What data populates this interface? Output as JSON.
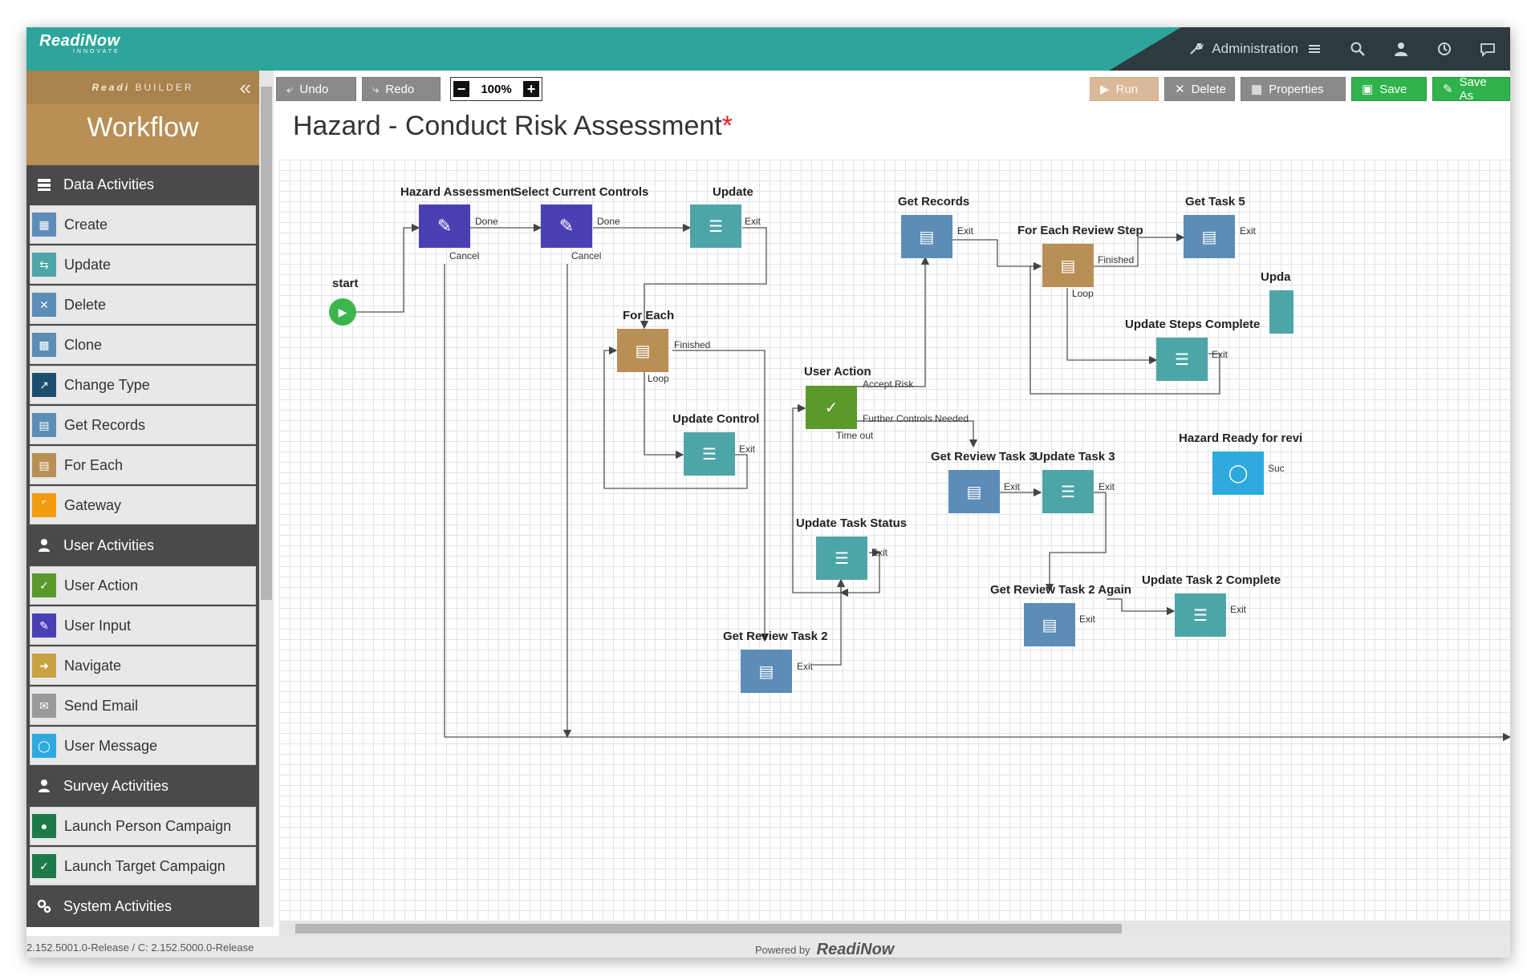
{
  "header": {
    "logo_main": "ReadiNow",
    "logo_sub": "INNOVATE",
    "admin_label": "Administration"
  },
  "sidebar": {
    "builder_small_a": "Readi",
    "builder_small_b": "BUILDER",
    "title": "Workflow",
    "categories": [
      {
        "label": "Data Activities"
      },
      {
        "label": "User Activities"
      },
      {
        "label": "Survey Activities"
      },
      {
        "label": "System Activities"
      }
    ],
    "items": [
      {
        "label": "Create",
        "color": "#5b8db8"
      },
      {
        "label": "Update",
        "color": "#4ea5a8"
      },
      {
        "label": "Delete",
        "color": "#5b8db8"
      },
      {
        "label": "Clone",
        "color": "#5b8db8"
      },
      {
        "label": "Change Type",
        "color": "#1e4e6e"
      },
      {
        "label": "Get Records",
        "color": "#5b8db8"
      },
      {
        "label": "For Each",
        "color": "#b88f55"
      },
      {
        "label": "Gateway",
        "color": "#f39c12"
      },
      {
        "label": "User Action",
        "color": "#5a9a2c"
      },
      {
        "label": "User Input",
        "color": "#4b3fb4"
      },
      {
        "label": "Navigate",
        "color": "#c8a243"
      },
      {
        "label": "Send Email",
        "color": "#9a9a9a"
      },
      {
        "label": "User Message",
        "color": "#2ea9e0"
      },
      {
        "label": "Launch Person Campaign",
        "color": "#1e7a4a"
      },
      {
        "label": "Launch Target Campaign",
        "color": "#1e7a4a"
      }
    ]
  },
  "toolbar": {
    "undo": "Undo",
    "redo": "Redo",
    "zoom": "100%",
    "run": "Run",
    "delete": "Delete",
    "properties": "Properties",
    "save": "Save",
    "save_as": "Save As"
  },
  "page": {
    "title": "Hazard - Conduct Risk Assessment",
    "unsaved_marker": "*"
  },
  "diagram": {
    "start": "start",
    "nodes": {
      "hazard_assessment": "Hazard Assessment",
      "select_current_controls": "Select Current Controls",
      "update": "Update",
      "for_each": "For Each",
      "update_control": "Update Control",
      "user_action": "User Action",
      "get_records": "Get Records",
      "for_each_review_step": "For Each Review Step",
      "get_task_5": "Get Task 5",
      "update_steps_complete": "Update Steps Complete",
      "upd_partial": "Upda",
      "hazard_ready": "Hazard Ready for revi",
      "get_review_task_3": "Get Review Task 3",
      "update_task_3": "Update Task 3",
      "update_task_status": "Update Task Status",
      "get_review_task_2_again": "Get Review Task 2 Again",
      "update_task_2_complete": "Update Task 2 Complete",
      "get_review_task_2": "Get Review Task 2"
    },
    "ports": {
      "done": "Done",
      "cancel": "Cancel",
      "exit": "Exit",
      "finished": "Finished",
      "loop": "Loop",
      "accept_risk": "Accept Risk",
      "further_controls": "Further Controls Needed",
      "time_out": "Time out",
      "suc": "Suc"
    }
  },
  "footer": {
    "version": "2.152.5001.0-Release / C: 2.152.5000.0-Release",
    "powered_by": "Powered by",
    "brand": "ReadiNow"
  }
}
